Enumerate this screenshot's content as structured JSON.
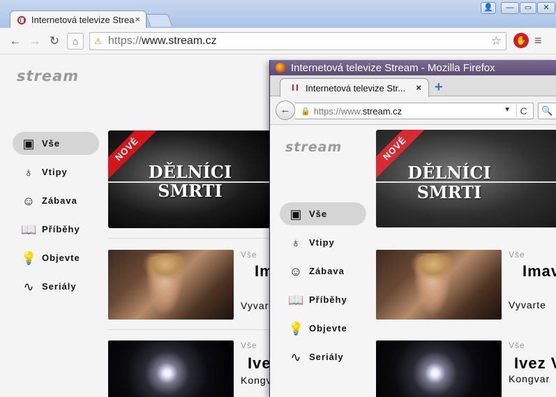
{
  "chrome": {
    "tab_title": "Internetová televize Stream",
    "tab_close": "×",
    "url_scheme": "https://",
    "url_host": "www.stream.cz",
    "window_buttons": {
      "user": "👤",
      "min": "—",
      "max": "▭",
      "close": "✕"
    },
    "nav": {
      "back": "←",
      "forward": "→",
      "reload": "↻",
      "home": "⌂"
    },
    "star": "☆",
    "menu": "≡",
    "ext": "✋",
    "warn": "⚠"
  },
  "site": {
    "logo": "stream",
    "menu": [
      {
        "label": "Vše",
        "icon": "play-box-icon",
        "glyph": "▣",
        "active": true
      },
      {
        "label": "Vtipy",
        "icon": "bomb-icon",
        "glyph": "♁",
        "active": false
      },
      {
        "label": "Zábava",
        "icon": "smiley-icon",
        "glyph": "☺",
        "active": false
      },
      {
        "label": "Příběhy",
        "icon": "book-icon",
        "glyph": "📖",
        "active": false
      },
      {
        "label": "Objevte",
        "icon": "lightbulb-icon",
        "glyph": "💡",
        "active": false
      },
      {
        "label": "Seriály",
        "icon": "pulse-icon",
        "glyph": "∿",
        "active": false
      }
    ],
    "menu_display": [
      "Vše",
      "Vtipy",
      "Zábava",
      "Příběhy",
      "Objevte",
      "Seriály"
    ],
    "hero": {
      "ribbon": "NOVÉ",
      "title_line1": "DĚLNÍCI",
      "title_line2": "SMRTI"
    },
    "cards": [
      {
        "category": "Vše",
        "title": "Im",
        "subtitle": "Vyvarte"
      },
      {
        "category": "Vše",
        "title": "Ivez",
        "subtitle": "Kongvar"
      }
    ]
  },
  "firefox": {
    "window_title": "Internetová televize Stream - Mozilla Firefox",
    "tab_title": "Internetová televize Str...",
    "tab_close": "×",
    "newtab": "+",
    "back": "←",
    "url_scheme": "https://",
    "url_prefix": "www.",
    "url_host": "stream.cz",
    "lock": "🔒",
    "dropdown": "▼",
    "reload": "C",
    "search": "🔍",
    "cards": [
      {
        "category": "Vše",
        "title": "Imav",
        "subtitle": "Vyvarte"
      },
      {
        "category": "Vše",
        "title": "Ivez V",
        "subtitle": "Kongvar"
      }
    ]
  }
}
